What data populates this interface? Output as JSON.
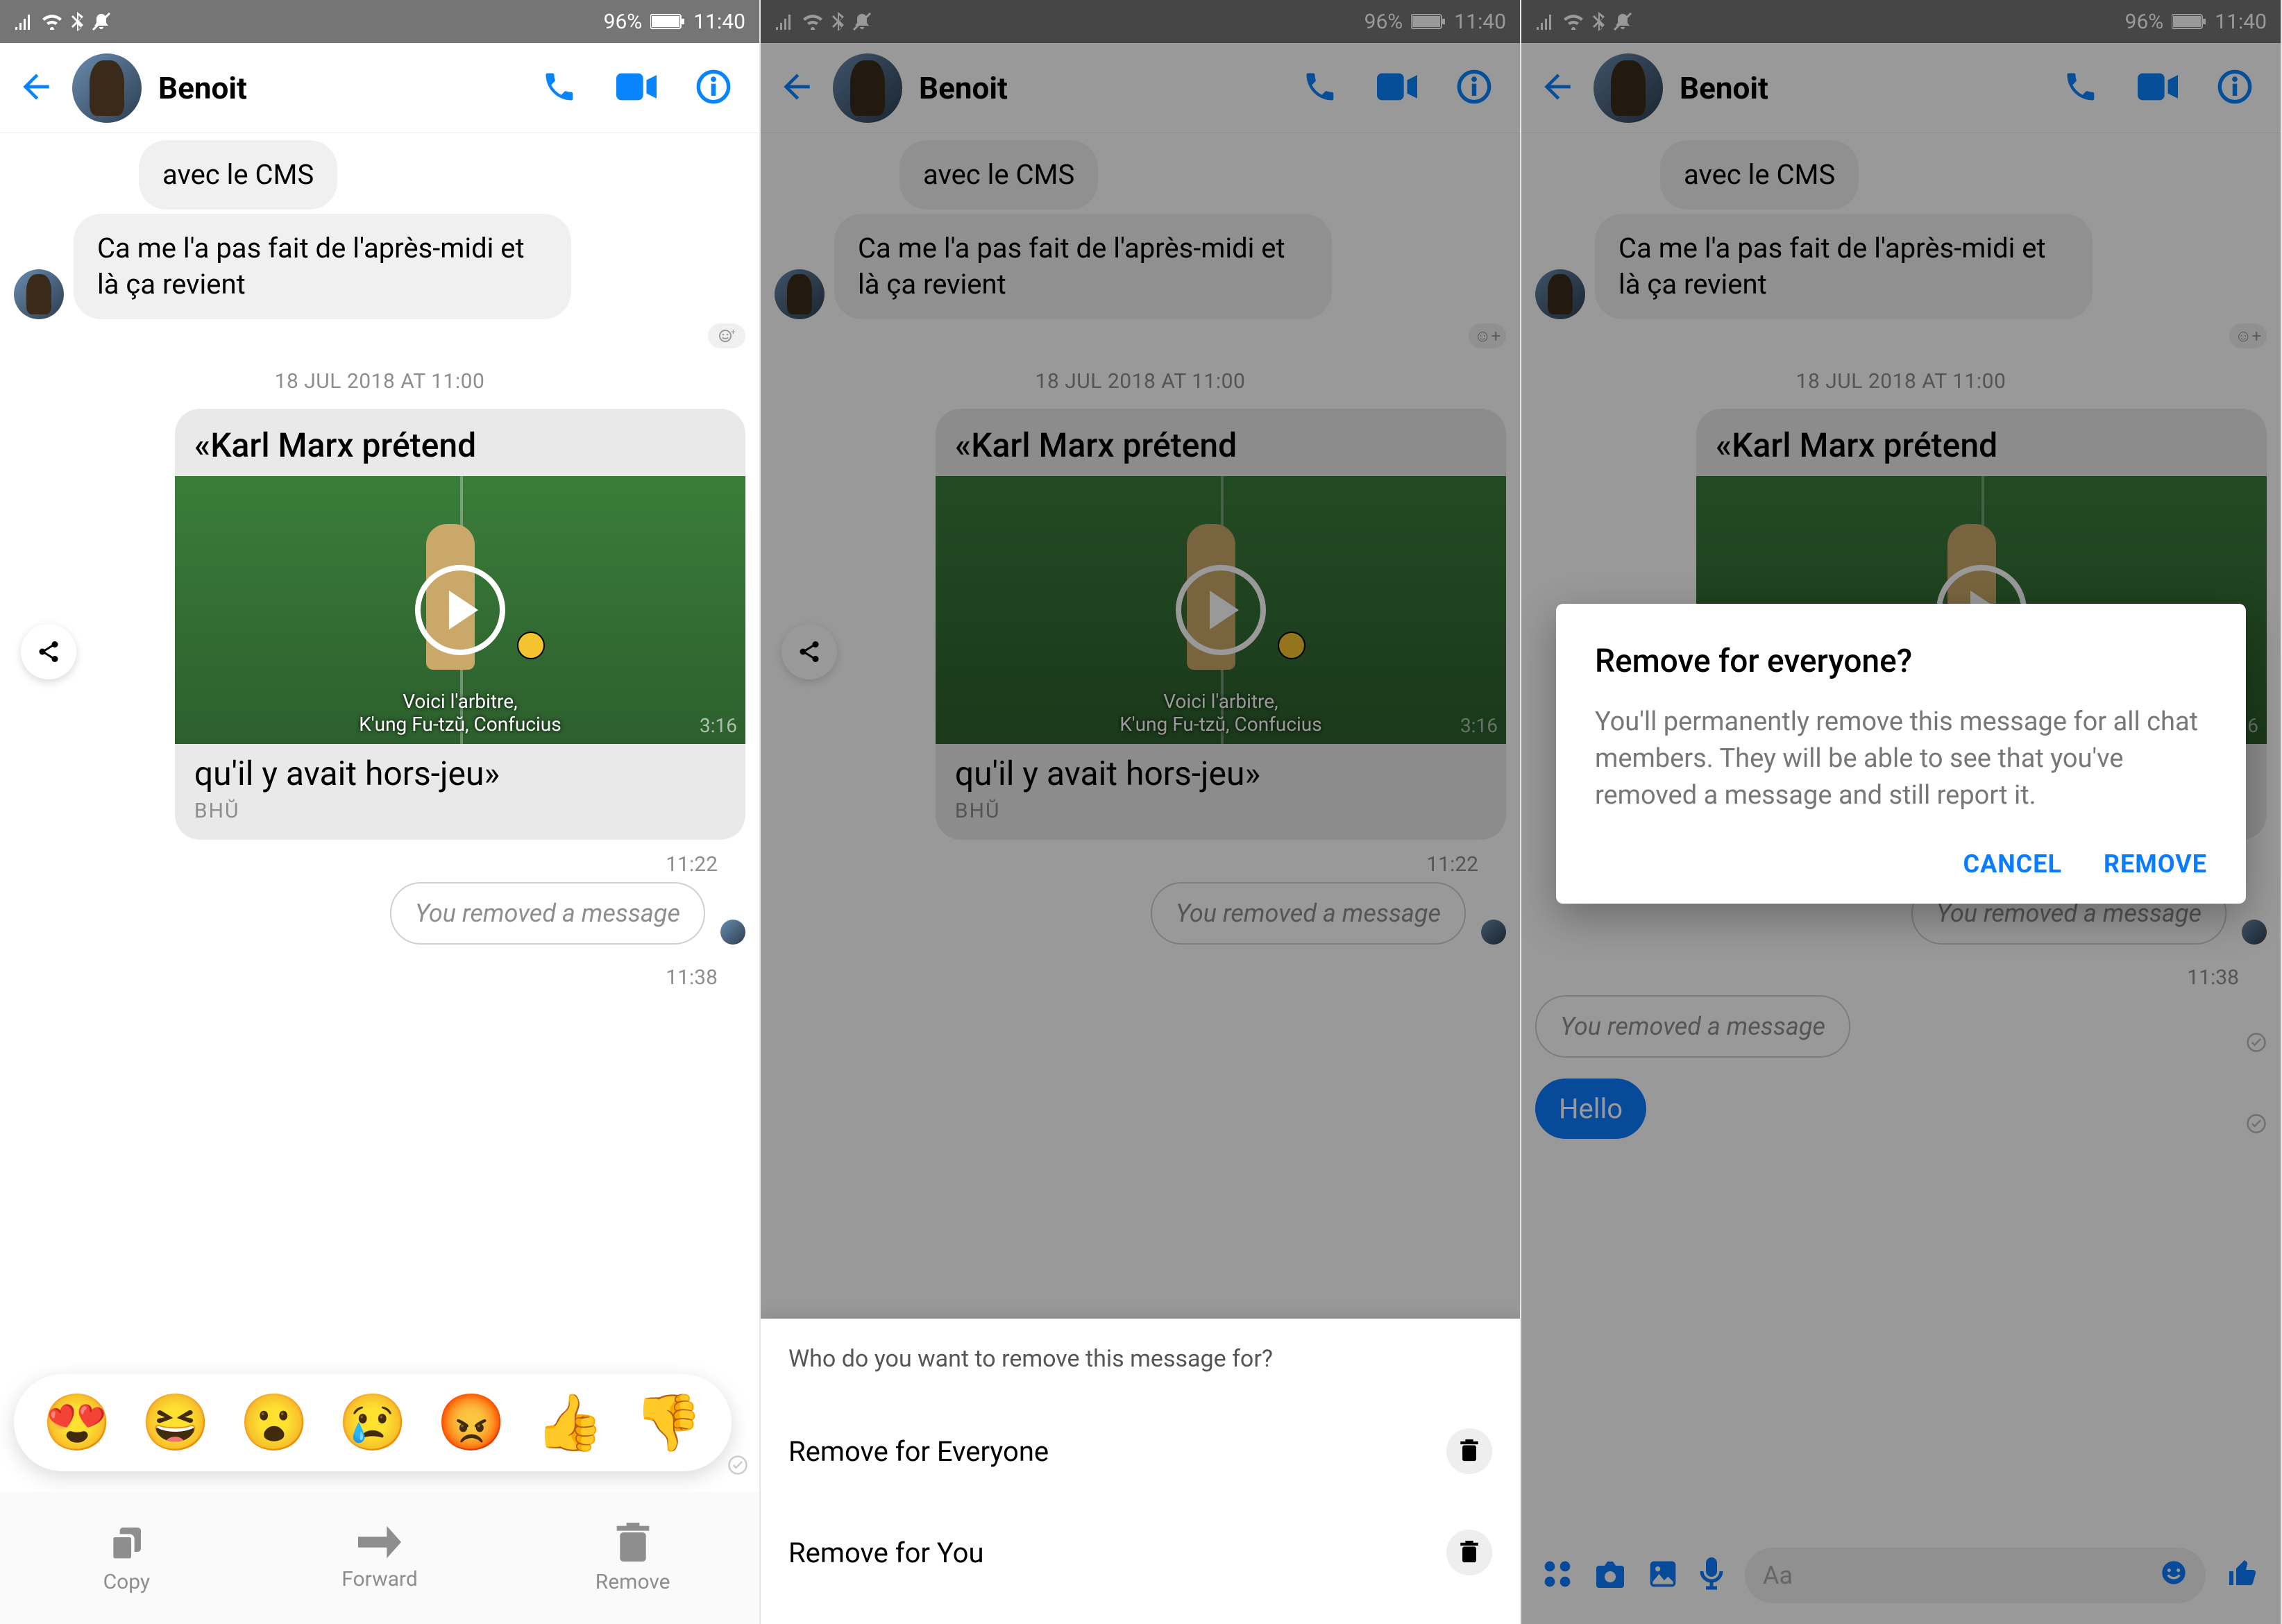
{
  "status_bar": {
    "battery_pct": "96%",
    "time": "11:40"
  },
  "header": {
    "contact_name": "Benoit"
  },
  "messages": {
    "msg1": "avec le CMS",
    "msg2": "Ca me l'a pas fait de l'après-midi et là ça revient",
    "date_stamp": "18 JUL 2018 AT 11:00",
    "video": {
      "title_top": "«Karl Marx prétend",
      "subtitle_line1": "Voici l'arbitre,",
      "subtitle_line2": "K'ung Fu-tzŭ, Confucius",
      "duration": "3:16",
      "title_bottom": "qu'il y avait hors-jeu»",
      "source": "BHŬ"
    },
    "time_1122": "11:22",
    "removed_text": "You removed a message",
    "time_1138": "11:38",
    "hello": "Hello"
  },
  "reactions": {
    "e1": "😍",
    "e2": "😆",
    "e3": "😮",
    "e4": "😢",
    "e5": "😡",
    "e6": "👍",
    "e7": "👎"
  },
  "actions": {
    "copy": "Copy",
    "forward": "Forward",
    "remove": "Remove"
  },
  "bottom_sheet": {
    "title": "Who do you want to remove this message for?",
    "opt1": "Remove for Everyone",
    "opt2": "Remove for You"
  },
  "dialog": {
    "title": "Remove for everyone?",
    "body": "You'll permanently remove this message for all chat members. They will be able to see that you've removed a message and still report it.",
    "cancel": "CANCEL",
    "remove": "REMOVE"
  },
  "composer": {
    "placeholder": "Aa"
  }
}
